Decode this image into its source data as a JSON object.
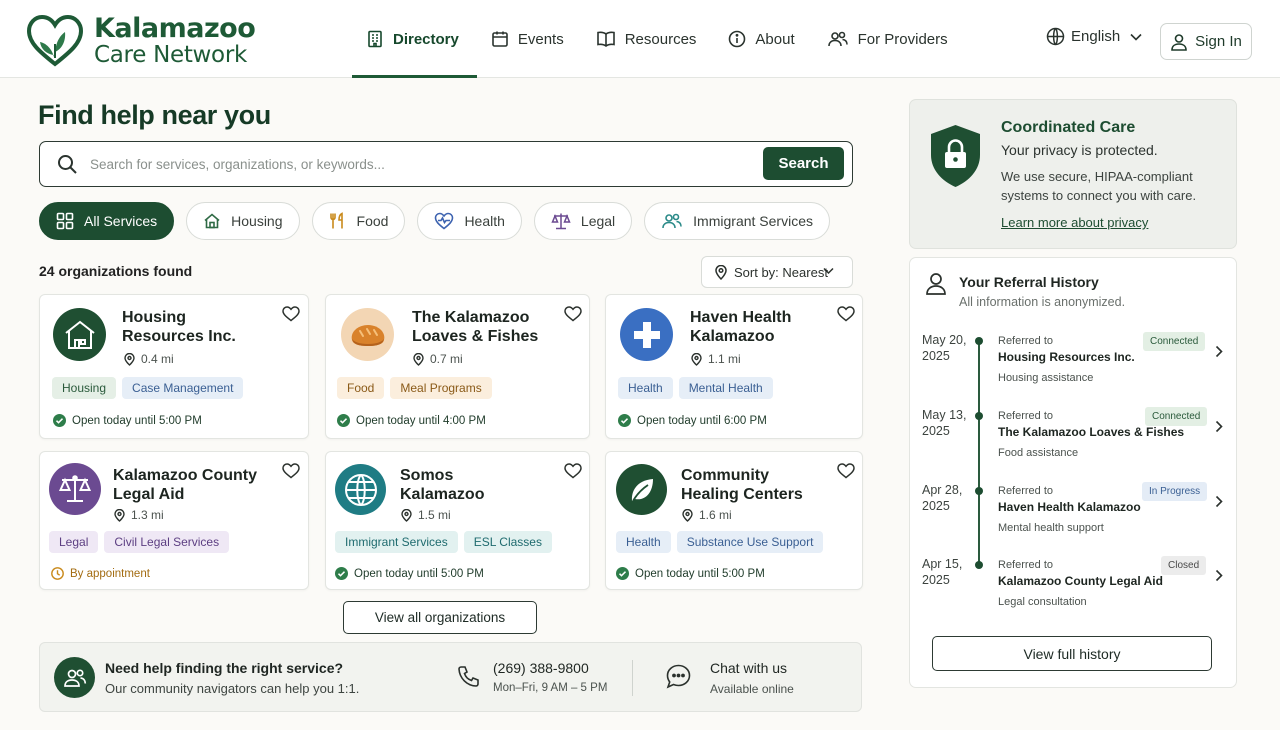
{
  "brand": {
    "line1": "Kalamazoo",
    "line2": "Care Network",
    "color": "#1e5a36"
  },
  "nav": {
    "items": [
      {
        "label": "Directory",
        "icon": "building-icon",
        "active": true
      },
      {
        "label": "Events",
        "icon": "calendar-icon"
      },
      {
        "label": "Resources",
        "icon": "book-icon"
      },
      {
        "label": "About",
        "icon": "info-icon"
      },
      {
        "label": "For Providers",
        "icon": "people-icon"
      }
    ],
    "language": "English",
    "sign_in": "Sign In"
  },
  "main": {
    "title": "Find help near you",
    "search": {
      "placeholder": "Search for services, organizations, or keywords...",
      "button": "Search"
    },
    "filters": [
      {
        "label": "All Services",
        "icon": "grid-icon",
        "active": true
      },
      {
        "label": "Housing",
        "icon": "house-icon"
      },
      {
        "label": "Food",
        "icon": "utensils-icon"
      },
      {
        "label": "Health",
        "icon": "heart-pulse-icon"
      },
      {
        "label": "Legal",
        "icon": "scales-icon"
      },
      {
        "label": "Immigrant Services",
        "icon": "people-icon"
      }
    ],
    "results_count": "24 organizations found",
    "sort": "Sort by: Nearest",
    "organizations": [
      {
        "name": "Housing Resources Inc.",
        "distance": "0.4 mi",
        "tags": [
          "Housing",
          "Case Management"
        ],
        "status": "Open today until 5:00 PM",
        "status_type": "open",
        "icon": "house-icon"
      },
      {
        "name": "The Kalamazoo Loaves & Fishes",
        "distance": "0.7 mi",
        "tags": [
          "Food",
          "Meal Programs"
        ],
        "status": "Open today until 4:00 PM",
        "status_type": "open",
        "icon": "bread-icon"
      },
      {
        "name": "Haven Health Kalamazoo",
        "distance": "1.1 mi",
        "tags": [
          "Health",
          "Mental Health"
        ],
        "status": "Open today until 6:00 PM",
        "status_type": "open",
        "icon": "medical-cross-icon"
      },
      {
        "name": "Kalamazoo County Legal Aid",
        "distance": "1.3 mi",
        "tags": [
          "Legal",
          "Civil Legal Services"
        ],
        "status": "By appointment",
        "status_type": "appointment",
        "icon": "scales-icon"
      },
      {
        "name": "Somos Kalamazoo",
        "distance": "1.5 mi",
        "tags": [
          "Immigrant Services",
          "ESL Classes"
        ],
        "status": "Open today until 5:00 PM",
        "status_type": "open",
        "icon": "globe-icon"
      },
      {
        "name": "Community Healing Centers",
        "distance": "1.6 mi",
        "tags": [
          "Health",
          "Substance Use Support"
        ],
        "status": "Open today until 5:00 PM",
        "status_type": "open",
        "icon": "leaf-icon"
      }
    ],
    "view_all": "View all organizations",
    "help": {
      "title": "Need help finding the right service?",
      "subtitle": "Our community navigators can help you 1:1.",
      "phone": "(269) 388-9800",
      "hours": "Mon–Fri, 9 AM – 5 PM",
      "chat": "Chat with us",
      "chat_status": "Available online"
    }
  },
  "privacy": {
    "title": "Coordinated Care",
    "subtitle": "Your privacy is protected.",
    "body": "We use secure, HIPAA-compliant systems to connect you with care.",
    "link": "Learn more about privacy"
  },
  "history": {
    "title": "Your Referral History",
    "subtitle": "All information is anonymized.",
    "items": [
      {
        "date_day": "May 20,",
        "date_year": "2025",
        "ref_label": "Referred to",
        "org": "Housing Resources Inc.",
        "service": "Housing assistance",
        "status": "Connected"
      },
      {
        "date_day": "May 13,",
        "date_year": "2025",
        "ref_label": "Referred to",
        "org": "The Kalamazoo Loaves & Fishes",
        "service": "Food assistance",
        "status": "Connected"
      },
      {
        "date_day": "Apr 28,",
        "date_year": "2025",
        "ref_label": "Referred to",
        "org": "Haven Health Kalamazoo",
        "service": "Mental health support",
        "status": "In Progress"
      },
      {
        "date_day": "Apr 15,",
        "date_year": "2025",
        "ref_label": "Referred to",
        "org": "Kalamazoo County Legal Aid",
        "service": "Legal consultation",
        "status": "Closed"
      }
    ],
    "full_history": "View full history"
  },
  "colors": {
    "primary": "#1d4d31",
    "connected_badge": "#e3efe4",
    "in_progress_badge": "#e4ecf6",
    "closed_badge": "#ececec"
  }
}
